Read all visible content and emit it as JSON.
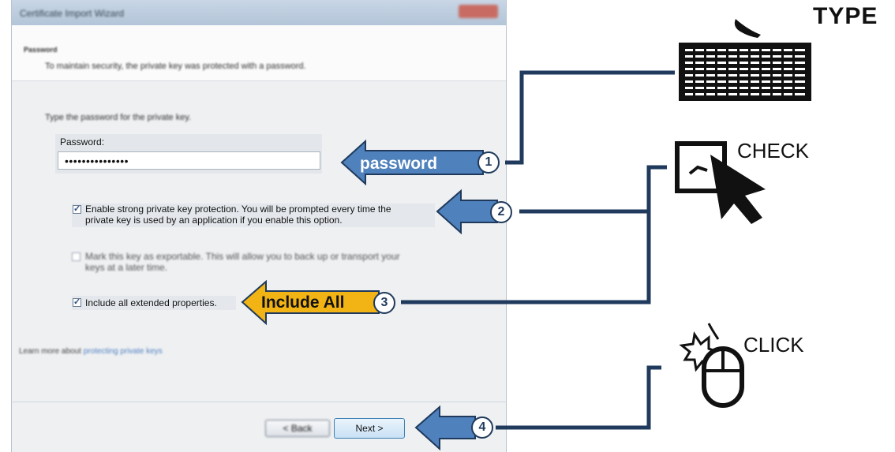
{
  "dialog": {
    "title": "Certificate Import Wizard",
    "header_title": "Password",
    "header_subtitle": "To maintain security, the private key was protected with a password.",
    "type_label": "Type the password for the private key.",
    "password_label": "Password:",
    "password_value": "•••••••••••••••",
    "options": [
      {
        "label_line1": "Enable strong private key protection. You will be prompted every time the",
        "label_line2": "private key is used by an application if you enable this option.",
        "checked": true
      },
      {
        "label_line1": "Mark this key as exportable. This will allow you to back up or transport your",
        "label_line2": "keys at a later time.",
        "checked": false
      },
      {
        "label_line1": "Include all extended properties.",
        "checked": true
      }
    ],
    "learn_more_prefix": "Learn more about",
    "learn_more_link": "protecting private keys",
    "back_label": "< Back",
    "next_label": "Next >"
  },
  "annotations": {
    "step1_text": "password",
    "step1_num": "1",
    "step2_num": "2",
    "step3_text": "Include All",
    "step3_num": "3",
    "step4_num": "4",
    "type_label": "TYPE",
    "check_label": "CHECK",
    "click_label": "CLICK",
    "arrow_color": "#4f81bd",
    "arrow_yellow": "#f2b314",
    "line_color": "#1f3a5c"
  }
}
